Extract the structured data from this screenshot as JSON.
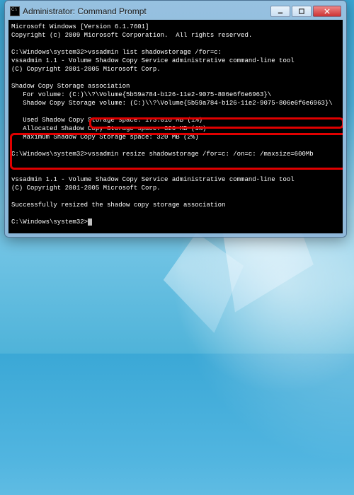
{
  "window": {
    "title": "Administrator: Command Prompt"
  },
  "terminal": {
    "header_line1": "Microsoft Windows [Version 6.1.7601]",
    "header_line2": "Copyright (c) 2009 Microsoft Corporation.  All rights reserved.",
    "prompt1": "C:\\Windows\\system32>",
    "cmd1": "vssadmin list shadowstorage /for=c:",
    "tool_line1": "vssadmin 1.1 - Volume Shadow Copy Service administrative command-line tool",
    "tool_line2": "(C) Copyright 2001-2005 Microsoft Corp.",
    "assoc_header": "Shadow Copy Storage association",
    "assoc_for": "   For volume: (C:)\\\\?\\Volume{5b59a784-b126-11e2-9075-806e6f6e6963}\\",
    "assoc_on": "   Shadow Copy Storage volume: (C:)\\\\?\\Volume{5b59a784-b126-11e2-9075-806e6f6e6963}\\",
    "assoc_used": "   Used Shadow Copy Storage space: 173.016 MB (1%)",
    "assoc_alloc": "   Allocated Shadow Copy Storage space: 320 MB (1%)",
    "assoc_max": "   Maximum Shadow Copy Storage space: 320 MB (2%)",
    "prompt2": "C:\\Windows\\system32>",
    "cmd2": "vssadmin resize shadowstorage /for=c: /on=c: /maxsize=600Mb",
    "tool_line3": "vssadmin 1.1 - Volume Shadow Copy Service administrative command-line tool",
    "tool_line4": "(C) Copyright 2001-2005 Microsoft Corp.",
    "success": "Successfully resized the shadow copy storage association",
    "prompt3": "C:\\Windows\\system32>"
  },
  "highlights": {
    "box1": "resize-command-highlight",
    "box2": "resize-output-highlight"
  }
}
